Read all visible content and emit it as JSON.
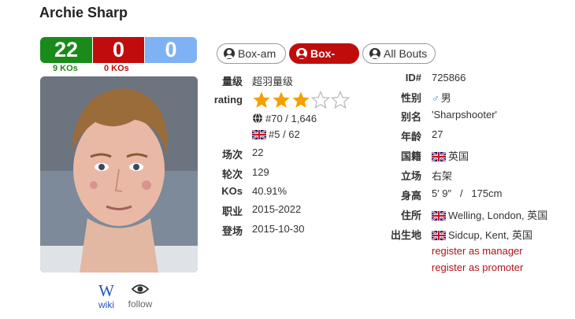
{
  "boxer": {
    "name": "Archie Sharp"
  },
  "record": {
    "wins": "22",
    "losses": "0",
    "draws": "0",
    "wins_ko": "9 KOs",
    "losses_ko": "0 KOs",
    "colors": {
      "win": "#1a8a1a",
      "loss": "#c10c0c",
      "draw": "#7fb2f5"
    }
  },
  "links": {
    "wiki": "wiki",
    "follow": "follow",
    "wiki_glyph": "W"
  },
  "tabs": [
    {
      "label": "Box-am",
      "active": false
    },
    {
      "label": "Box-pro",
      "active": true
    },
    {
      "label": "All Bouts",
      "active": false
    }
  ],
  "left": {
    "division_label": "量级",
    "division": "超羽量级",
    "rating_label": "rating",
    "rating_stars": 3,
    "rating_max": 5,
    "world_rank": "#70 / 1,646",
    "country_rank": "#5 / 62",
    "bouts_label": "场次",
    "bouts": "22",
    "rounds_label": "轮次",
    "rounds": "129",
    "kos_label": "KOs",
    "kos": "40.91%",
    "career_label": "职业",
    "career": "2015-2022",
    "debut_label": "登场",
    "debut": "2015-10-30"
  },
  "right": {
    "id_label": "ID#",
    "id": "725866",
    "sex_label": "性别",
    "sex_symbol": "♂",
    "sex": "男",
    "alias_label": "别名",
    "alias": "'Sharpshooter'",
    "age_label": "年龄",
    "age": "27",
    "nationality_label": "国籍",
    "nationality": "英国",
    "stance_label": "立场",
    "stance": "右架",
    "height_label": "身高",
    "height": "5′ 9″   /   175cm",
    "residence_label": "住所",
    "residence": "Welling, London, 英国",
    "birthplace_label": "出生地",
    "birthplace": "Sidcup, Kent, 英国",
    "register_manager": "register as manager",
    "register_promoter": "register as promoter"
  }
}
